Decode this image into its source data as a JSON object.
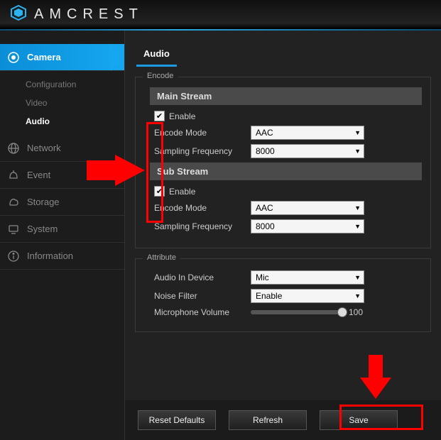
{
  "brand": {
    "name": "AMCREST"
  },
  "sidebar": {
    "camera": "Camera",
    "camera_sub": {
      "configuration": "Configuration",
      "video": "Video",
      "audio": "Audio"
    },
    "network": "Network",
    "event": "Event",
    "storage": "Storage",
    "system": "System",
    "information": "Information"
  },
  "tabs": {
    "audio": "Audio"
  },
  "encode": {
    "legend": "Encode",
    "main_stream": "Main Stream",
    "sub_stream": "Sub Stream",
    "enable": "Enable",
    "encode_mode": "Encode Mode",
    "sampling_frequency": "Sampling Frequency",
    "main": {
      "enable": true,
      "mode": "AAC",
      "sampling": "8000"
    },
    "sub": {
      "enable": true,
      "mode": "AAC",
      "sampling": "8000"
    }
  },
  "attribute": {
    "legend": "Attribute",
    "audio_in_device": "Audio In Device",
    "noise_filter": "Noise Filter",
    "microphone_volume": "Microphone Volume",
    "audio_in_value": "Mic",
    "noise_filter_value": "Enable",
    "mic_volume_value": "100"
  },
  "buttons": {
    "reset": "Reset Defaults",
    "refresh": "Refresh",
    "save": "Save"
  }
}
